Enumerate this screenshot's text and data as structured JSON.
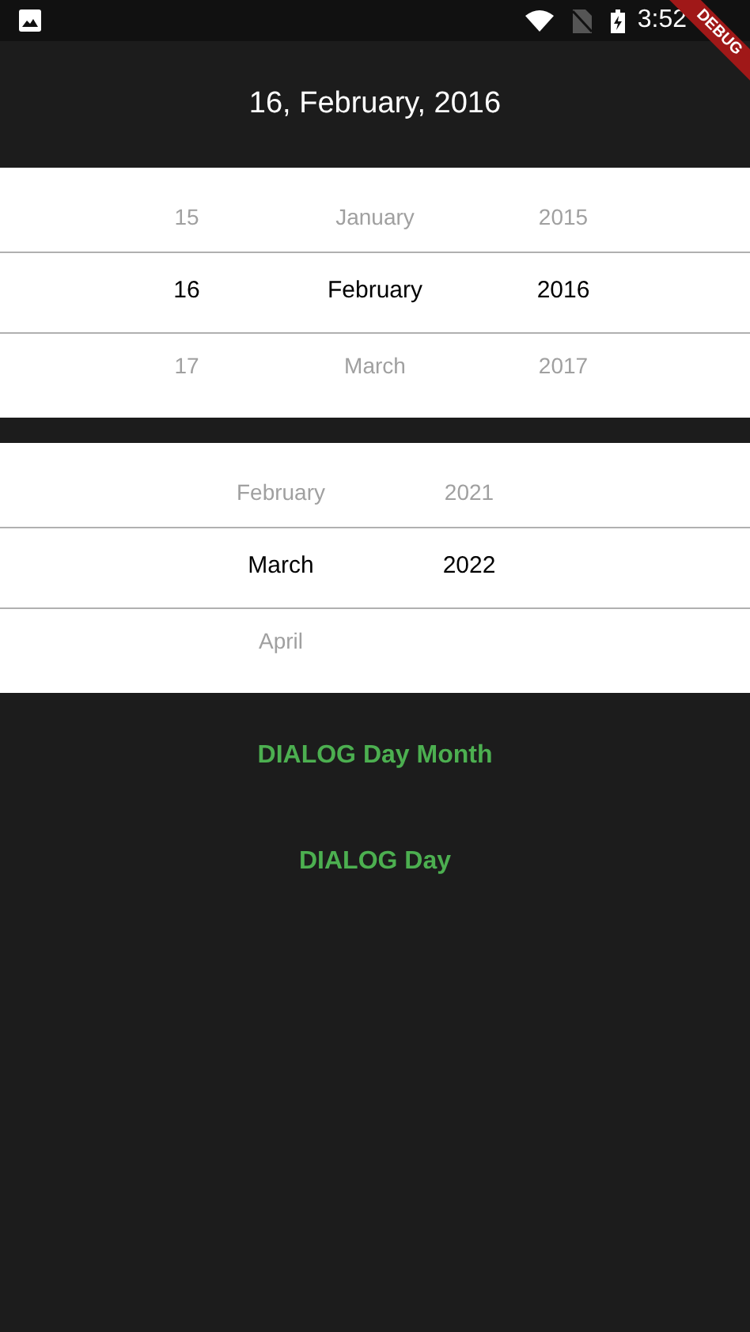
{
  "status_bar": {
    "time": "3:52"
  },
  "debug_banner": "DEBUG",
  "title": "16, February, 2016",
  "pickers": [
    {
      "columns": [
        {
          "items": [
            {
              "label": "15",
              "selected": false
            },
            {
              "label": "16",
              "selected": true
            },
            {
              "label": "17",
              "selected": false
            }
          ]
        },
        {
          "items": [
            {
              "label": "January",
              "selected": false
            },
            {
              "label": "February",
              "selected": true
            },
            {
              "label": "March",
              "selected": false
            }
          ]
        },
        {
          "items": [
            {
              "label": "2015",
              "selected": false
            },
            {
              "label": "2016",
              "selected": true
            },
            {
              "label": "2017",
              "selected": false
            }
          ]
        }
      ]
    },
    {
      "columns": [
        {
          "items": [
            {
              "label": "February",
              "selected": false
            },
            {
              "label": "March",
              "selected": true
            },
            {
              "label": "April",
              "selected": false
            }
          ]
        },
        {
          "items": [
            {
              "label": "2021",
              "selected": false
            },
            {
              "label": "2022",
              "selected": true
            }
          ]
        }
      ]
    }
  ],
  "buttons": [
    "DIALOG Day Month",
    "DIALOG Day"
  ]
}
